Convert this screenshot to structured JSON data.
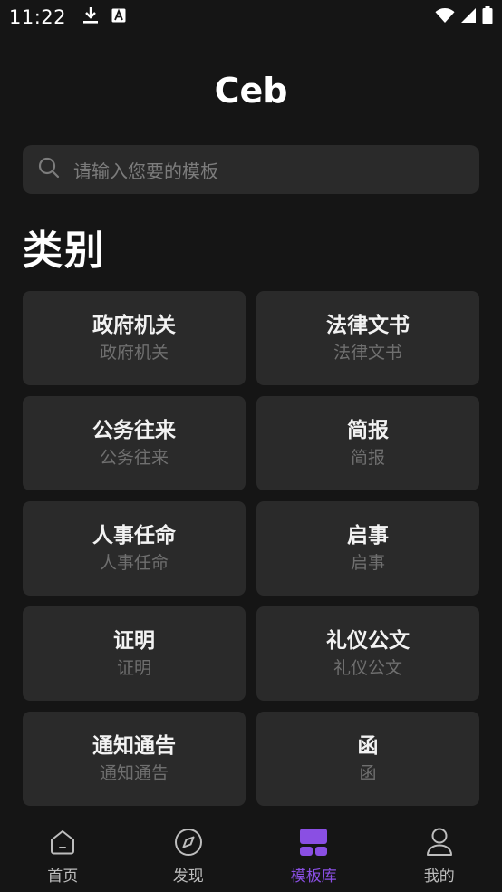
{
  "status_bar": {
    "time": "11:22",
    "left_icons": [
      "download-icon",
      "font-a-icon"
    ],
    "right_icons": [
      "wifi-icon",
      "cell-signal-icon",
      "battery-icon"
    ]
  },
  "app": {
    "title": "Ceb"
  },
  "search": {
    "placeholder": "请输入您要的模板",
    "icon": "search-icon"
  },
  "section": {
    "title": "类别"
  },
  "categories": [
    {
      "title": "政府机关",
      "subtitle": "政府机关"
    },
    {
      "title": "法律文书",
      "subtitle": "法律文书"
    },
    {
      "title": "公务往来",
      "subtitle": "公务往来"
    },
    {
      "title": "简报",
      "subtitle": "简报"
    },
    {
      "title": "人事任命",
      "subtitle": "人事任命"
    },
    {
      "title": "启事",
      "subtitle": "启事"
    },
    {
      "title": "证明",
      "subtitle": "证明"
    },
    {
      "title": "礼仪公文",
      "subtitle": "礼仪公文"
    },
    {
      "title": "通知通告",
      "subtitle": "通知通告"
    },
    {
      "title": "函",
      "subtitle": "函"
    }
  ],
  "bottom_nav": {
    "items": [
      {
        "label": "首页",
        "icon": "home-icon"
      },
      {
        "label": "发现",
        "icon": "compass-icon"
      },
      {
        "label": "模板库",
        "icon": "template-library-icon",
        "active": true
      },
      {
        "label": "我的",
        "icon": "profile-icon"
      }
    ],
    "active_color": "#8a4fe3"
  },
  "colors": {
    "background": "#151515",
    "card": "#2a2a2a",
    "accent": "#8a4fe3"
  }
}
